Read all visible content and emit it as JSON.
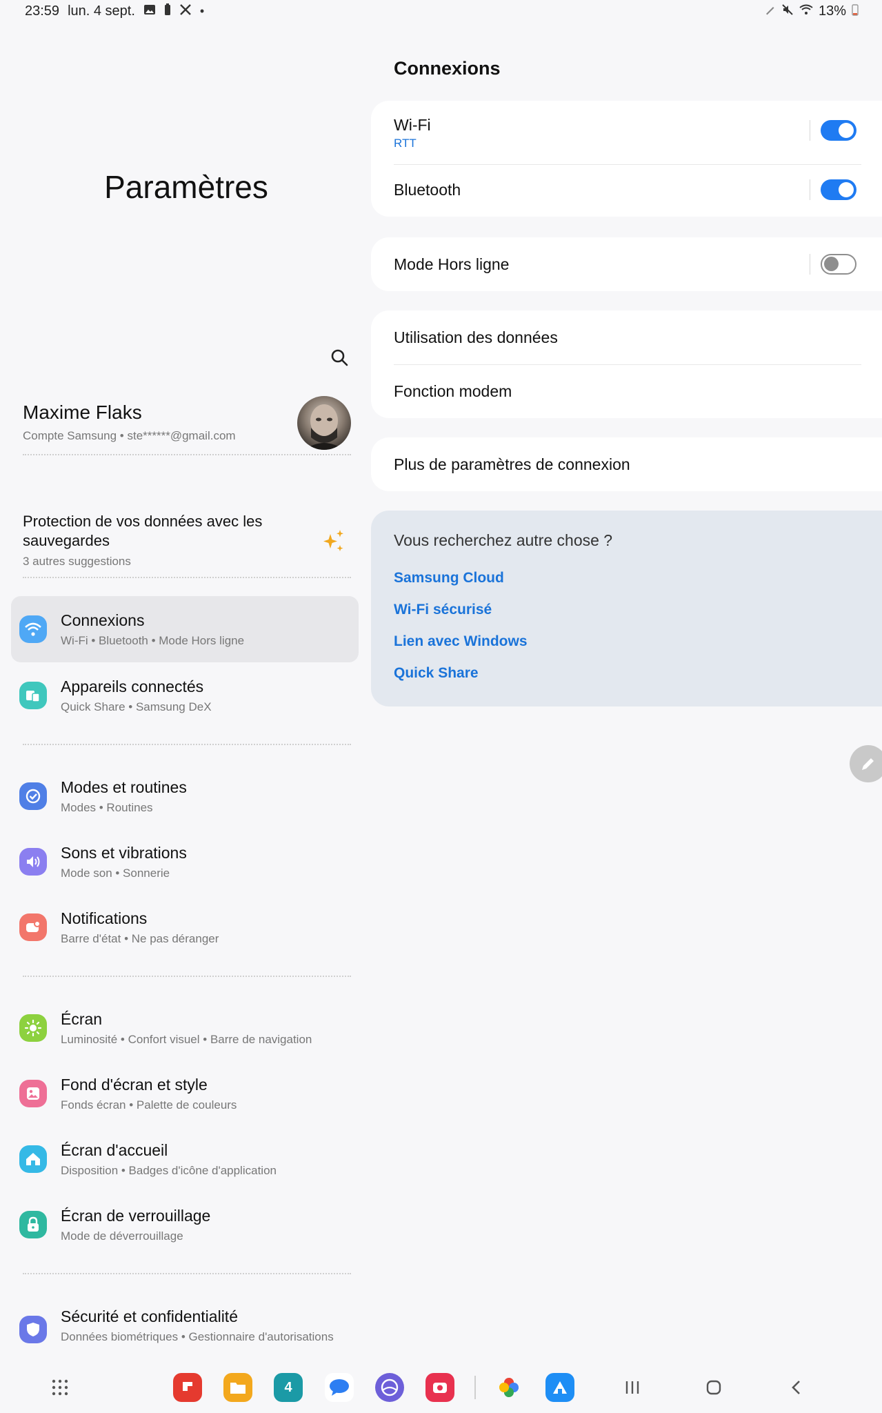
{
  "status_bar": {
    "time": "23:59",
    "date": "lun. 4 sept.",
    "battery": "13%",
    "icons_left": [
      "gallery-icon",
      "battery-saver-icon",
      "tools-icon",
      "dot-icon"
    ],
    "icons_right": [
      "pen-icon",
      "mute-icon",
      "wifi-icon",
      "battery-icon"
    ]
  },
  "left": {
    "title": "Paramètres",
    "profile": {
      "name": "Maxime Flaks",
      "subtitle": "Compte Samsung  •  ste******@gmail.com"
    },
    "suggestion": {
      "title": "Protection de vos données avec les sauvegardes",
      "subtitle": "3 autres suggestions"
    },
    "menu": [
      {
        "title": "Connexions",
        "subtitle": "Wi-Fi  •  Bluetooth  •  Mode Hors ligne",
        "icon": "wifi-icon",
        "color": "#4fa8f5"
      },
      {
        "title": "Appareils connectés",
        "subtitle": "Quick Share  •  Samsung DeX",
        "icon": "devices-icon",
        "color": "#3fc7bd"
      },
      {
        "title": "Modes et routines",
        "subtitle": "Modes  •  Routines",
        "icon": "routines-icon",
        "color": "#4f7fe6"
      },
      {
        "title": "Sons et vibrations",
        "subtitle": "Mode son  •  Sonnerie",
        "icon": "sound-icon",
        "color": "#8b7ff0"
      },
      {
        "title": "Notifications",
        "subtitle": "Barre d'état  •  Ne pas déranger",
        "icon": "notifications-icon",
        "color": "#f2766b"
      },
      {
        "title": "Écran",
        "subtitle": "Luminosité  •  Confort visuel  •  Barre de navigation",
        "icon": "brightness-icon",
        "color": "#8dd13f"
      },
      {
        "title": "Fond d'écran et style",
        "subtitle": "Fonds écran  •  Palette de couleurs",
        "icon": "wallpaper-icon",
        "color": "#ee6f96"
      },
      {
        "title": "Écran d'accueil",
        "subtitle": "Disposition  •  Badges d'icône d'application",
        "icon": "home-icon",
        "color": "#35b9e6"
      },
      {
        "title": "Écran de verrouillage",
        "subtitle": "Mode de déverrouillage",
        "icon": "lock-icon",
        "color": "#2fb8a0"
      },
      {
        "title": "Sécurité et confidentialité",
        "subtitle": "Données biométriques  •  Gestionnaire d'autorisations",
        "icon": "shield-icon",
        "color": "#6a78e8"
      }
    ]
  },
  "right": {
    "title": "Connexions",
    "wifi": {
      "title": "Wi-Fi",
      "subtitle": "RTT",
      "on": true
    },
    "bluetooth": {
      "title": "Bluetooth",
      "on": true
    },
    "airplane": {
      "title": "Mode Hors ligne",
      "on": false
    },
    "data_usage": "Utilisation des données",
    "hotspot": "Fonction modem",
    "more": "Plus de paramètres de connexion",
    "looking": {
      "title": "Vous recherchez autre chose ?",
      "links": [
        "Samsung Cloud",
        "Wi-Fi sécurisé",
        "Lien avec Windows",
        "Quick Share"
      ]
    }
  },
  "dock": {
    "apps": [
      "apps-grid-icon",
      "flipboard-icon",
      "files-icon",
      "calendar-icon",
      "messages-icon",
      "internet-icon",
      "screen-recorder-icon",
      "photos-icon",
      "store-icon"
    ],
    "calendar_day": "4",
    "nav": [
      "recents-button",
      "home-button",
      "back-button"
    ]
  },
  "colors": {
    "accent": "#1f7bf2",
    "link": "#1a73d9",
    "active_bg": "#e7e7ea"
  }
}
